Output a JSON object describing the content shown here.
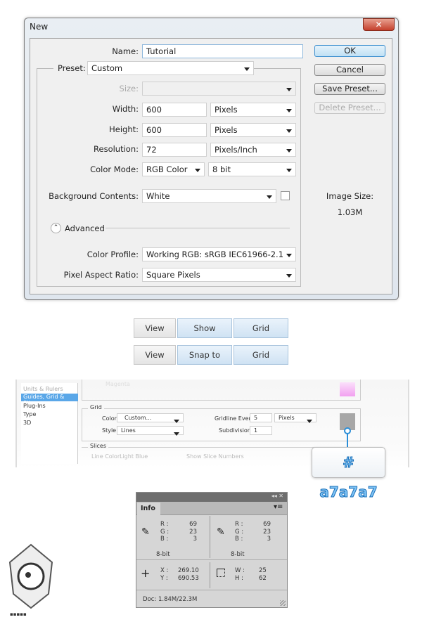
{
  "dialog": {
    "title": "New",
    "close_icon": "close-icon",
    "name_label": "Name:",
    "name_value": "Tutorial",
    "preset_label": "Preset:",
    "preset_value": "Custom",
    "size_label": "Size:",
    "size_value": "",
    "width_label": "Width:",
    "width_value": "600",
    "width_unit": "Pixels",
    "height_label": "Height:",
    "height_value": "600",
    "height_unit": "Pixels",
    "resolution_label": "Resolution:",
    "resolution_value": "72",
    "resolution_unit": "Pixels/Inch",
    "color_mode_label": "Color Mode:",
    "color_mode_value": "RGB Color",
    "bit_depth": "8 bit",
    "background_label": "Background Contents:",
    "background_value": "White",
    "advanced_label": "Advanced",
    "color_profile_label": "Color Profile:",
    "color_profile_value": "Working RGB:  sRGB IEC61966-2.1",
    "pixel_aspect_label": "Pixel Aspect Ratio:",
    "pixel_aspect_value": "Square Pixels",
    "ok": "OK",
    "cancel": "Cancel",
    "save_preset": "Save Preset...",
    "delete_preset": "Delete Preset...",
    "image_size_label": "Image Size:",
    "image_size_value": "1.03M"
  },
  "toolbar_rows": [
    [
      "View",
      "Show",
      "Grid"
    ],
    [
      "View",
      "Snap to",
      "Grid"
    ]
  ],
  "prefs": {
    "sidebar": [
      "Units & Rulers",
      "Guides, Grid & Slices",
      "Plug-Ins",
      "Type",
      "3D"
    ],
    "guides_color_label": "Color:",
    "guides_color_value": "Magenta",
    "grid_title": "Grid",
    "color_label": "Color:",
    "color_value": "Custom...",
    "style_label": "Style:",
    "style_value": "Lines",
    "gridline_label": "Gridline Every:",
    "gridline_value": "5",
    "gridline_unit": "Pixels",
    "subdiv_label": "Subdivisions:",
    "subdiv_value": "1",
    "slices_title": "Slices",
    "line_color_label": "Line Color:",
    "line_color_value": "Light Blue",
    "show_slice_numbers": "Show Slice Numbers",
    "grid_swatch_color": "#a7a7a7",
    "callout": "# a7a7a7"
  },
  "info": {
    "tab": "Info",
    "left": {
      "r_label": "R :",
      "g_label": "G :",
      "b_label": "B :",
      "r": "69",
      "g": "23",
      "b": "3",
      "depth": "8-bit"
    },
    "right": {
      "r_label": "R :",
      "g_label": "G :",
      "b_label": "B :",
      "r": "69",
      "g": "23",
      "b": "3",
      "depth": "8-bit"
    },
    "x_label": "X :",
    "y_label": "Y :",
    "x": "269.10",
    "y": "690.53",
    "w_label": "W :",
    "h_label": "H :",
    "w": "25",
    "h": "62",
    "doc": "Doc: 1.84M/22.3M"
  },
  "logo_text": "آریا گستر افزار"
}
